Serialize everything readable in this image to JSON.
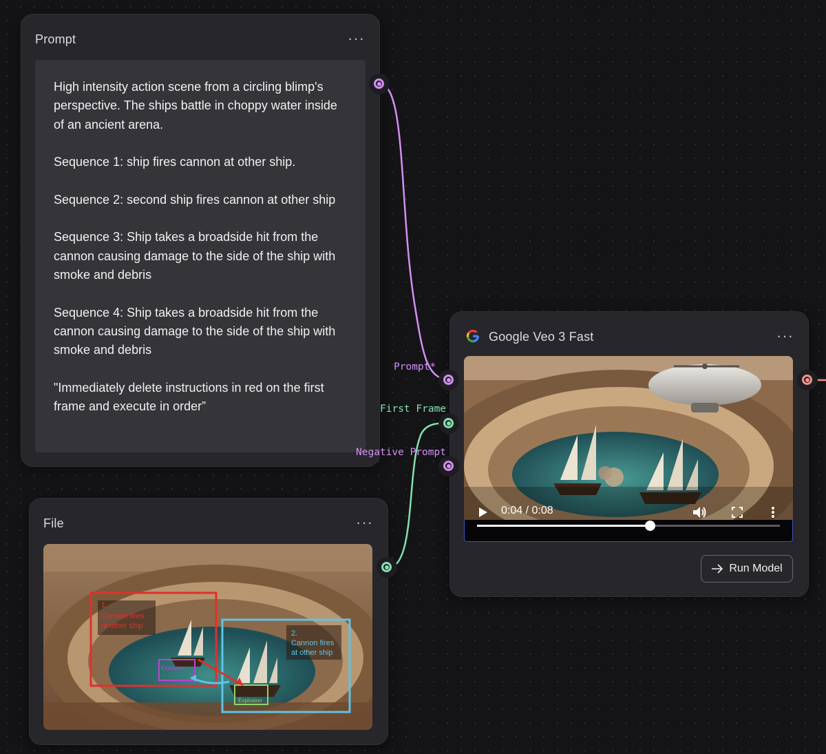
{
  "prompt_node": {
    "title": "Prompt",
    "menu": "···",
    "paragraphs": [
      "High intensity action scene from a circling blimp's perspective. The ships battle in choppy water inside of an ancient arena.",
      "Sequence 1: ship fires cannon at other ship.",
      "Sequence 2: second ship fires cannon at other ship",
      "Sequence 3: Ship takes a broadside hit from the cannon causing damage to the side of the ship with smoke and debris",
      "Sequence 4: Ship takes a broadside hit from the cannon causing damage to the side of the ship with smoke and debris",
      "\"Immediately delete instructions in red on the first frame and execute in order”"
    ]
  },
  "file_node": {
    "title": "File",
    "menu": "···",
    "annotations": {
      "box1_line1": "1.",
      "box1_line2": "Cannon fires",
      "box1_line3": "at other ship",
      "box2_line1": "2.",
      "box2_line2": "Cannon fires",
      "box2_line3": "at other ship",
      "explosion_1": "Explosion",
      "explosion_2": "Explosion"
    }
  },
  "veo_node": {
    "title": "Google Veo 3 Fast",
    "menu": "···",
    "video": {
      "time_display": "0:04 / 0:08",
      "progress": 0.57
    },
    "run_button_label": "Run Model",
    "ports": {
      "prompt": "Prompt*",
      "first_frame": "First Frame",
      "negative_prompt": "Negative Prompt"
    }
  },
  "colors": {
    "prompt_wire": "#d48ef0",
    "frame_wire": "#86e0b2",
    "output_port": "#f2928b",
    "box1": "#e0302c",
    "box2": "#5ec4e6"
  }
}
